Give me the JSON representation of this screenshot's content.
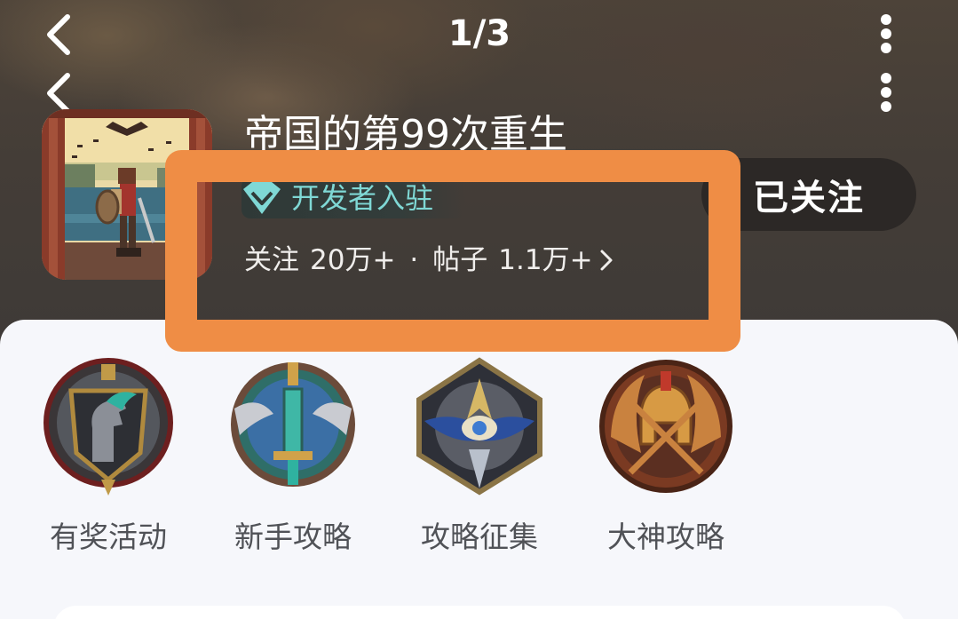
{
  "header": {
    "page_indicator": "1/3",
    "back_icon": "chevron-left-icon",
    "more_icon": "more-vertical-icon"
  },
  "game": {
    "title": "帝国的第99次重生",
    "developer_badge": "开发者入驻",
    "follow_button": "已关注",
    "stats": {
      "followers_label": "关注",
      "followers_value": "20万+",
      "separator": "·",
      "posts_label": "帖子",
      "posts_value": "1.1万+"
    }
  },
  "entries": [
    {
      "label": "有奖活动",
      "icon": "knight-emblem-icon"
    },
    {
      "label": "新手攻略",
      "icon": "winged-sword-emblem-icon"
    },
    {
      "label": "攻略征集",
      "icon": "eye-emblem-icon"
    },
    {
      "label": "大神攻略",
      "icon": "spartan-helmet-emblem-icon"
    }
  ],
  "colors": {
    "highlight": "#ef8d45",
    "badge_text": "#7fd8d5",
    "panel_bg": "#f6f7fb",
    "header_bg": "#433c36"
  }
}
